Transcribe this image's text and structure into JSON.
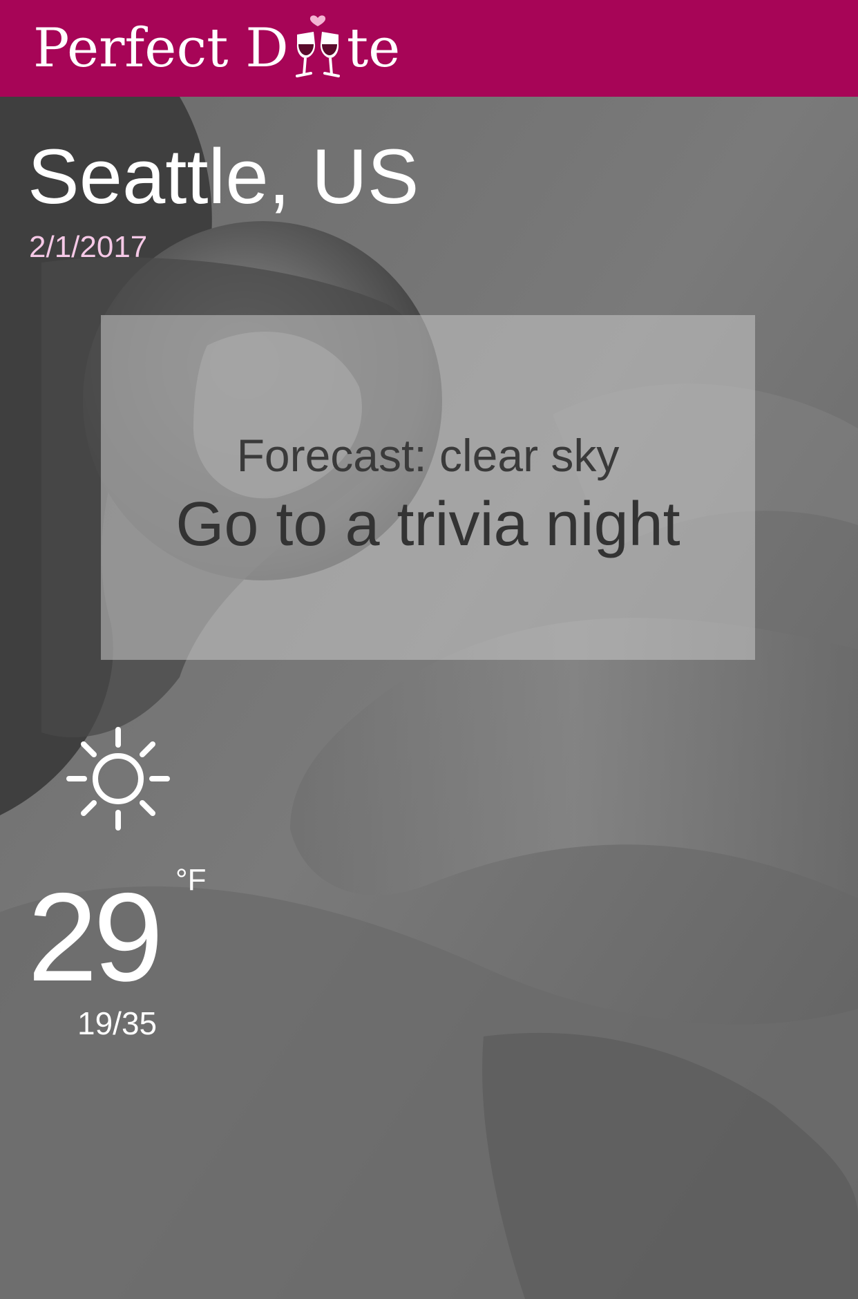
{
  "app": {
    "logo_text_left": "Perfect D",
    "logo_text_right": "te",
    "brand_color": "#a70557"
  },
  "location": {
    "city": "Seattle, US",
    "date": "2/1/2017"
  },
  "forecast": {
    "label": "Forecast: clear sky",
    "suggestion": "Go to a trivia night"
  },
  "weather": {
    "icon": "sun-icon",
    "temperature": "29",
    "unit": "°F",
    "low_high": "19/35"
  },
  "background": {
    "description_icon": "rose-on-fabric-photo"
  }
}
